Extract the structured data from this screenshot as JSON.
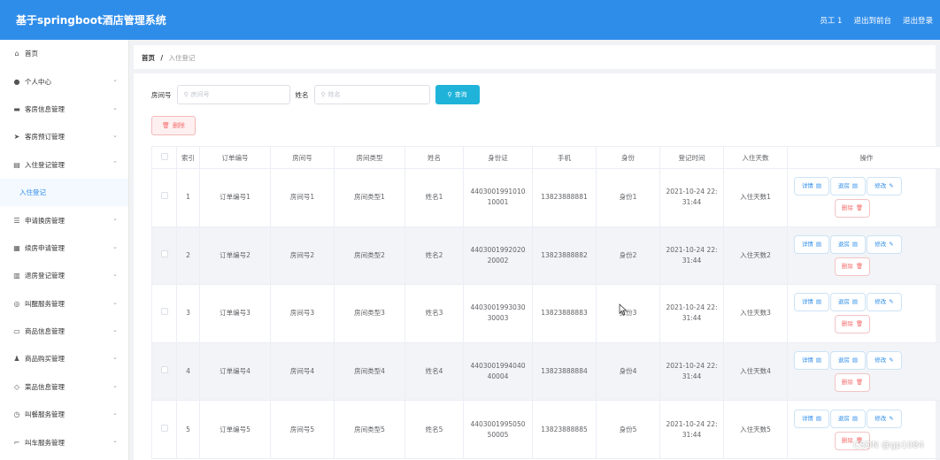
{
  "header": {
    "title": "基于springboot酒店管理系统",
    "user": "员工 1",
    "to_front": "退出到前台",
    "logout": "退出登录"
  },
  "sidebar": {
    "items": [
      {
        "label": "首页",
        "icon": "home-icon",
        "glyph": "⌂",
        "arrow": ""
      },
      {
        "label": "个人中心",
        "icon": "user-icon",
        "glyph": "●",
        "arrow": "⌄"
      },
      {
        "label": "客房信息管理",
        "icon": "bed-icon",
        "glyph": "▬",
        "arrow": "⌄"
      },
      {
        "label": "客房预订管理",
        "icon": "send-icon",
        "glyph": "➤",
        "arrow": "⌄"
      },
      {
        "label": "入住登记管理",
        "icon": "document-icon",
        "glyph": "▤",
        "arrow": "⌃"
      },
      {
        "label": "入住登记",
        "icon": "",
        "glyph": "",
        "arrow": "",
        "sub": true
      },
      {
        "label": "申请换房管理",
        "icon": "list-icon",
        "glyph": "☰",
        "arrow": "⌄"
      },
      {
        "label": "续房申请管理",
        "icon": "grid-icon",
        "glyph": "▦",
        "arrow": "⌄"
      },
      {
        "label": "退房登记管理",
        "icon": "clipboard-icon",
        "glyph": "▥",
        "arrow": "⌄"
      },
      {
        "label": "叫醒服务管理",
        "icon": "circle-icon",
        "glyph": "◎",
        "arrow": "⌄"
      },
      {
        "label": "商品信息管理",
        "icon": "card-icon",
        "glyph": "▭",
        "arrow": "⌄"
      },
      {
        "label": "商品购买管理",
        "icon": "person-icon",
        "glyph": "♟",
        "arrow": "⌄"
      },
      {
        "label": "菜品信息管理",
        "icon": "tag-icon",
        "glyph": "◇",
        "arrow": "⌄"
      },
      {
        "label": "叫餐服务管理",
        "icon": "clock-icon",
        "glyph": "◷",
        "arrow": "⌄"
      },
      {
        "label": "叫车服务管理",
        "icon": "car-icon",
        "glyph": "⌐",
        "arrow": "⌄"
      }
    ]
  },
  "breadcrumb": {
    "home": "首页",
    "sep": "/",
    "current": "入住登记"
  },
  "search": {
    "room_label": "房间号",
    "room_placeholder": "房间号",
    "name_label": "姓名",
    "name_placeholder": "姓名",
    "query_button": "查询"
  },
  "toolbar": {
    "delete_label": "删除"
  },
  "table": {
    "headers": [
      "",
      "索引",
      "订单编号",
      "房间号",
      "房间类型",
      "姓名",
      "身份证",
      "手机",
      "身份",
      "登记时间",
      "入住天数",
      "操作"
    ],
    "ops": {
      "detail": "详情",
      "checkout": "退房",
      "edit": "修改",
      "delete": "删除"
    },
    "rows": [
      {
        "index": "1",
        "order": "订单编号1",
        "room": "房间号1",
        "type": "房间类型1",
        "name": "姓名1",
        "id_a": "4403001991010",
        "id_b": "10001",
        "phone": "13823888881",
        "role": "身份1",
        "time_a": "2021-10-24 22:",
        "time_b": "31:44",
        "days": "入住天数1"
      },
      {
        "index": "2",
        "order": "订单编号2",
        "room": "房间号2",
        "type": "房间类型2",
        "name": "姓名2",
        "id_a": "4403001992020",
        "id_b": "20002",
        "phone": "13823888882",
        "role": "身份2",
        "time_a": "2021-10-24 22:",
        "time_b": "31:44",
        "days": "入住天数2"
      },
      {
        "index": "3",
        "order": "订单编号3",
        "room": "房间号3",
        "type": "房间类型3",
        "name": "姓名3",
        "id_a": "4403001993030",
        "id_b": "30003",
        "phone": "13823888883",
        "role": "身份3",
        "time_a": "2021-10-24 22:",
        "time_b": "31:44",
        "days": "入住天数3"
      },
      {
        "index": "4",
        "order": "订单编号4",
        "room": "房间号4",
        "type": "房间类型4",
        "name": "姓名4",
        "id_a": "4403001994040",
        "id_b": "40004",
        "phone": "13823888884",
        "role": "身份4",
        "time_a": "2021-10-24 22:",
        "time_b": "31:44",
        "days": "入住天数4"
      },
      {
        "index": "5",
        "order": "订单编号5",
        "room": "房间号5",
        "type": "房间类型5",
        "name": "姓名5",
        "id_a": "4403001995050",
        "id_b": "50005",
        "phone": "13823888885",
        "role": "身份5",
        "time_a": "2021-10-24 22:",
        "time_b": "31:44",
        "days": "入住天数5"
      }
    ]
  },
  "watermark": "CSDN @gp1084",
  "colors": {
    "primary": "#2f8dea",
    "query_button": "#1fb3d9",
    "danger": "#f56c6c"
  }
}
